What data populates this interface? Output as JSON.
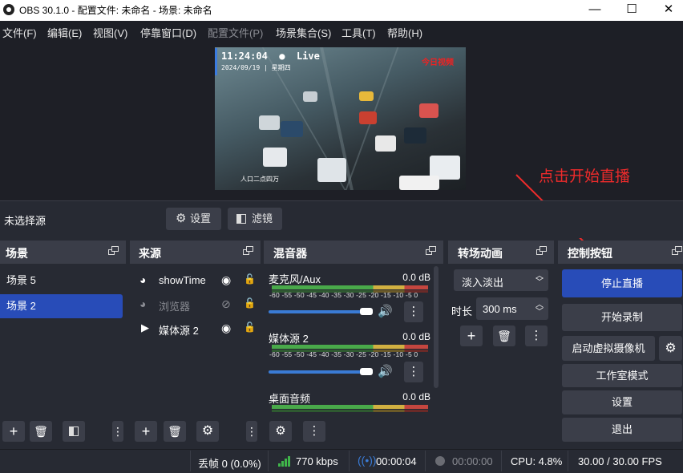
{
  "window": {
    "title": "OBS 30.1.0 - 配置文件: 未命名 - 场景: 未命名",
    "minimize": "—",
    "maximize": "☐",
    "close": "✕"
  },
  "menu": [
    {
      "label": "文件(F)",
      "enabled": true
    },
    {
      "label": "编辑(E)",
      "enabled": true
    },
    {
      "label": "视图(V)",
      "enabled": true
    },
    {
      "label": "停靠窗口(D)",
      "enabled": true
    },
    {
      "label": "配置文件(P)",
      "enabled": false
    },
    {
      "label": "场景集合(S)",
      "enabled": true
    },
    {
      "label": "工具(T)",
      "enabled": true
    },
    {
      "label": "帮助(H)",
      "enabled": true
    }
  ],
  "preview": {
    "time": "11:24:04",
    "live": "Live",
    "date": "2024/09/19 | 星期四",
    "logo": "今日视频",
    "caption": "人口二点四万"
  },
  "annotation": {
    "text": "点击开始直播",
    "color": "#ee2b2b"
  },
  "source_toolbar": {
    "no_source": "未选择源",
    "settings": "设置",
    "filters": "滤镜"
  },
  "scenes": {
    "title": "场景",
    "items": [
      {
        "label": "场景 5",
        "selected": false
      },
      {
        "label": "场景 2",
        "selected": true
      }
    ]
  },
  "sources": {
    "title": "来源",
    "items": [
      {
        "label": "showTime",
        "icon": "globe-icon",
        "visible": true,
        "locked": false
      },
      {
        "label": "浏览器",
        "icon": "globe-icon",
        "visible": false,
        "locked": false
      },
      {
        "label": "媒体源 2",
        "icon": "play-icon",
        "visible": true,
        "locked": false
      }
    ]
  },
  "mixer": {
    "title": "混音器",
    "scale": "-60 -55 -50 -45 -40 -35 -30 -25 -20 -15 -10 -5  0",
    "channels": [
      {
        "name": "麦克风/Aux",
        "db": "0.0 dB"
      },
      {
        "name": "媒体源 2",
        "db": "0.0 dB"
      },
      {
        "name": "桌面音频",
        "db": "0.0 dB"
      }
    ]
  },
  "transitions": {
    "title": "转场动画",
    "selected": "淡入淡出",
    "duration_label": "时长",
    "duration": "300 ms"
  },
  "controls": {
    "title": "控制按钮",
    "stop_stream": "停止直播",
    "start_record": "开始录制",
    "virtual_cam": "启动虚拟摄像机",
    "studio_mode": "工作室模式",
    "settings": "设置",
    "exit": "退出"
  },
  "status": {
    "dropped": "丢帧 0 (0.0%)",
    "bitrate": "770 kbps",
    "stream_time": "00:00:04",
    "record_time": "00:00:00",
    "cpu": "CPU: 4.8%",
    "fps": "30.00 / 30.00 FPS"
  },
  "colors": {
    "accent": "#284cb8",
    "panel": "#272a33",
    "header": "#3a3d48",
    "button": "#3b3e49",
    "bitrate_green": "#3fb54a"
  }
}
